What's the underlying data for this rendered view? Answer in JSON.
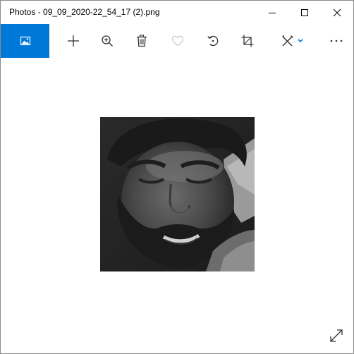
{
  "window": {
    "title": "Photos - 09_09_2020-22_54_17 (2).png"
  },
  "caption_buttons": {
    "minimize_icon": "minimize-icon",
    "maximize_icon": "maximize-icon",
    "close_icon": "close-icon"
  },
  "toolbar": {
    "view_tab_icon": "image-icon",
    "items": [
      {
        "name": "add-button",
        "icon": "plus-icon"
      },
      {
        "name": "zoom-button",
        "icon": "zoom-in-icon"
      },
      {
        "name": "delete-button",
        "icon": "trash-icon"
      },
      {
        "name": "favorite-button",
        "icon": "heart-icon"
      },
      {
        "name": "rotate-button",
        "icon": "rotate-icon"
      },
      {
        "name": "crop-button",
        "icon": "crop-icon"
      },
      {
        "name": "edit-button",
        "icon": "edit-create-icon"
      },
      {
        "name": "more-button",
        "icon": "more-icon"
      }
    ]
  },
  "colors": {
    "accent": "#0078d7",
    "icon": "#333333",
    "icon_disabled": "#c8c8c8"
  },
  "viewer": {
    "image_description_icon": "photo-image",
    "expand_icon": "expand-icon"
  }
}
